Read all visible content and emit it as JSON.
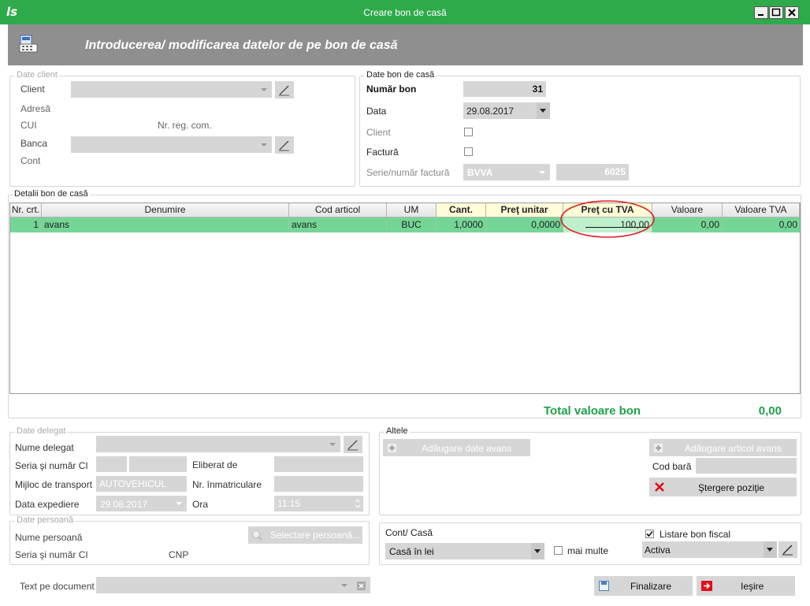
{
  "window": {
    "title": "Creare bon de casă"
  },
  "header": {
    "title": "Introducerea/ modificarea datelor de pe bon de casă"
  },
  "client": {
    "group_title": "Date client",
    "client_label": "Client",
    "adresa_label": "Adresă",
    "cui_label": "CUI",
    "nrreg_label": "Nr. reg. com.",
    "banca_label": "Banca",
    "cont_label": "Cont"
  },
  "bon": {
    "group_title": "Date bon de casă",
    "numar_label": "Număr bon",
    "numar_value": "31",
    "data_label": "Data",
    "data_value": "29.08.2017",
    "client_label": "Client",
    "factura_label": "Factură",
    "serie_label": "Serie/număr factură",
    "serie_value": "BVVA",
    "numar_factura_value": "6025"
  },
  "details": {
    "group_title": "Detalii bon de casă",
    "columns": [
      "Nr. crt.",
      "Denumire",
      "Cod articol",
      "UM",
      "Cant.",
      "Preţ unitar",
      "Preţ cu TVA",
      "Valoare",
      "Valoare TVA"
    ],
    "rows": [
      {
        "nr": "1",
        "denumire": "avans",
        "cod": "avans",
        "um": "BUC",
        "cant": "1,0000",
        "pret_unitar": "0,0000",
        "pret_tva": "100,00",
        "valoare": "0,00",
        "valoare_tva": "0,00"
      }
    ]
  },
  "total": {
    "label": "Total valoare bon",
    "value": "0,00"
  },
  "delegat": {
    "group_title": "Date delegat",
    "nume_label": "Nume delegat",
    "seria_label": "Seria şi număr CI",
    "eliberat_label": "Eliberat de",
    "mijloc_label": "Mijloc de transport",
    "mijloc_value": "AUTOVEHICUL",
    "nrinm_label": "Nr. înmatriculare",
    "data_label": "Data expediere",
    "data_value": "29.08.2017",
    "ora_label": "Ora",
    "ora_value": "11:15"
  },
  "altele": {
    "group_title": "Altele",
    "add_avans_label": "Adăugare date avans",
    "add_articol_label": "Adăugare articol avans",
    "cod_bara_label": "Cod bară",
    "stergere_label": "Ştergere poziţie"
  },
  "persoana": {
    "group_title": "Date persoană",
    "nume_label": "Nume persoană",
    "seria_label": "Seria şi număr CI",
    "cnp_label": "CNP",
    "selectare_label": "Selectare persoană..."
  },
  "cont": {
    "label": "Cont/ Casă",
    "value": "Casă în lei",
    "mai_multe_label": "mai multe",
    "listare_label": "Listare bon fiscal",
    "printer_value": "Activa"
  },
  "footer": {
    "text_label": "Text pe document",
    "finalizare_label": "Finalizare",
    "iesire_label": "Ieşire"
  },
  "colors": {
    "accent": "#2eaa4a",
    "row_selected": "#74d596",
    "total": "#1ea14a",
    "highlight": "#e02020"
  }
}
